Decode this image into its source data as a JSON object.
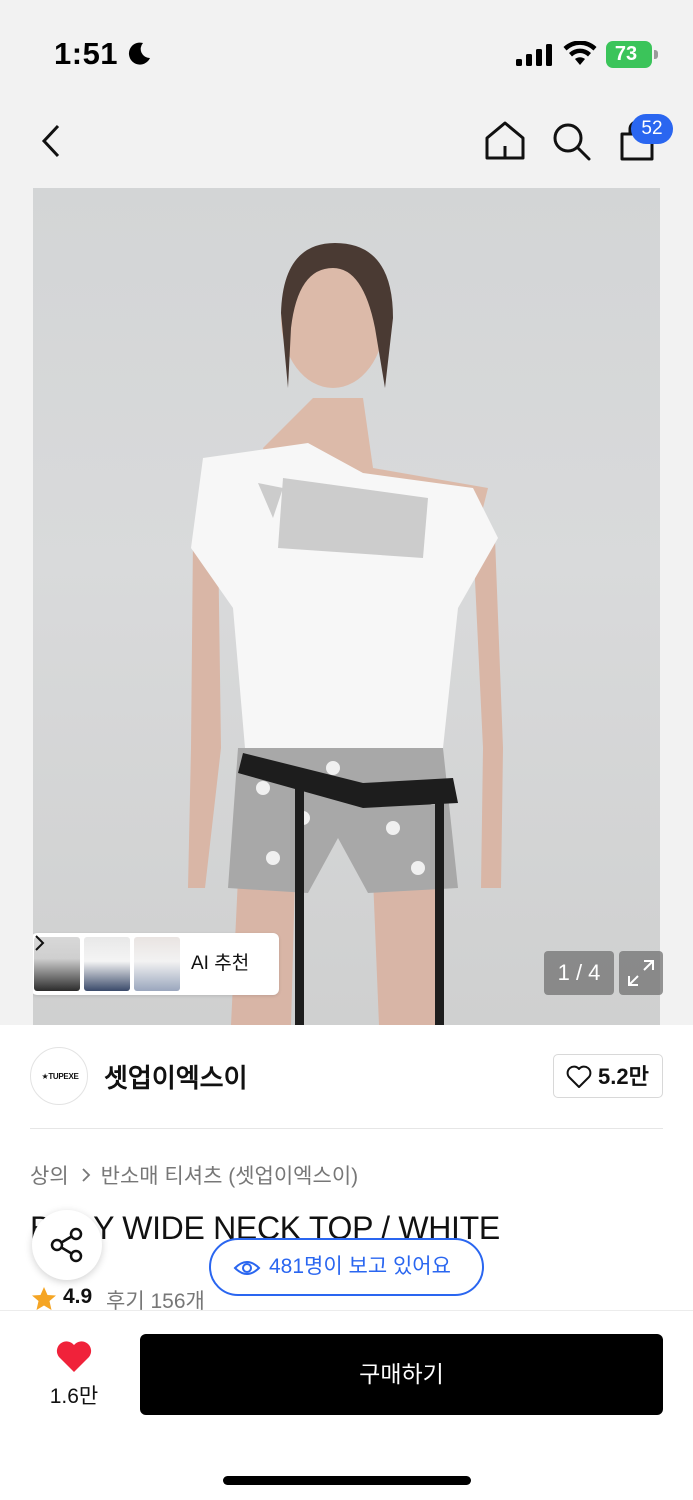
{
  "status_bar": {
    "time": "1:51",
    "battery": "73",
    "icons": [
      "moon-icon",
      "signal-icon",
      "wifi-icon",
      "battery-icon"
    ]
  },
  "nav": {
    "icons": [
      "back-arrow-icon",
      "home-icon",
      "search-icon",
      "cart-icon"
    ],
    "cart_count": "52"
  },
  "gallery": {
    "ai_label": "AI 추천",
    "counter": "1 / 4",
    "expand_icon": "expand-icon"
  },
  "brand": {
    "logo_text": "★TUPEXE",
    "name": "셋업이엑스이",
    "like_count": "5.2만"
  },
  "breadcrumb": {
    "level1": "상의",
    "level2": "반소매 티셔츠 (셋업이엑스이)"
  },
  "product": {
    "title": "BABY WIDE NECK TOP / WHITE",
    "rating": "4.9",
    "review_text": "후기 156개"
  },
  "viewers": {
    "text": "481명이 보고 있어요"
  },
  "bottom": {
    "wish_count": "1.6만",
    "buy_label": "구매하기"
  },
  "colors": {
    "accent_blue": "#2a66f0",
    "wish_red": "#f0223a",
    "battery_green": "#3bc45a",
    "star_orange": "#f5a524"
  }
}
